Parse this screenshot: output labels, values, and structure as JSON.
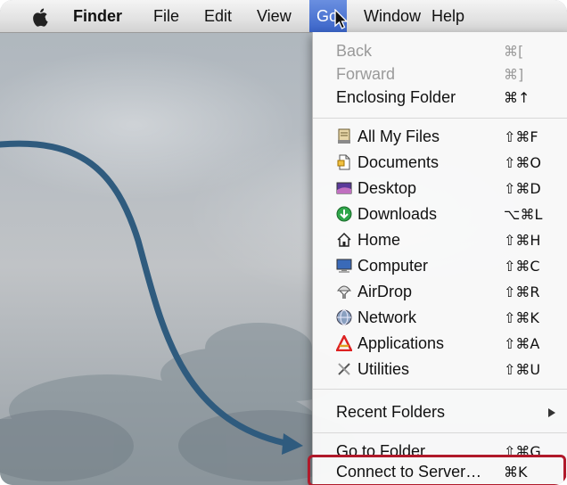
{
  "menubar": {
    "apple_icon": "apple-logo-icon",
    "items": [
      "Finder",
      "File",
      "Edit",
      "View",
      "Go",
      "Window",
      "Help"
    ]
  },
  "go_menu": {
    "nav": [
      {
        "label": "Back",
        "shortcut": "⌘[",
        "disabled": true
      },
      {
        "label": "Forward",
        "shortcut": "⌘]",
        "disabled": true
      },
      {
        "label": "Enclosing Folder",
        "shortcut": "⌘↑",
        "disabled": false
      }
    ],
    "places": [
      {
        "label": "All My Files",
        "shortcut": "⇧⌘F",
        "icon": "all-my-files-icon"
      },
      {
        "label": "Documents",
        "shortcut": "⇧⌘O",
        "icon": "documents-icon"
      },
      {
        "label": "Desktop",
        "shortcut": "⇧⌘D",
        "icon": "desktop-icon"
      },
      {
        "label": "Downloads",
        "shortcut": "⌥⌘L",
        "icon": "downloads-icon"
      },
      {
        "label": "Home",
        "shortcut": "⇧⌘H",
        "icon": "home-icon"
      },
      {
        "label": "Computer",
        "shortcut": "⇧⌘C",
        "icon": "computer-icon"
      },
      {
        "label": "AirDrop",
        "shortcut": "⇧⌘R",
        "icon": "airdrop-icon"
      },
      {
        "label": "Network",
        "shortcut": "⇧⌘K",
        "icon": "network-icon"
      },
      {
        "label": "Applications",
        "shortcut": "⇧⌘A",
        "icon": "applications-icon"
      },
      {
        "label": "Utilities",
        "shortcut": "⇧⌘U",
        "icon": "utilities-icon"
      }
    ],
    "recent_folders": "Recent Folders",
    "go_to_folder": {
      "label": "Go to Folder…",
      "shortcut": "⇧⌘G"
    },
    "connect_to_server": {
      "label": "Connect to Server…",
      "shortcut": "⌘K"
    }
  },
  "colors": {
    "highlight_box": "#b0192a",
    "arrow": "#2f5b7e",
    "menu_selection": "#3a64c8"
  }
}
